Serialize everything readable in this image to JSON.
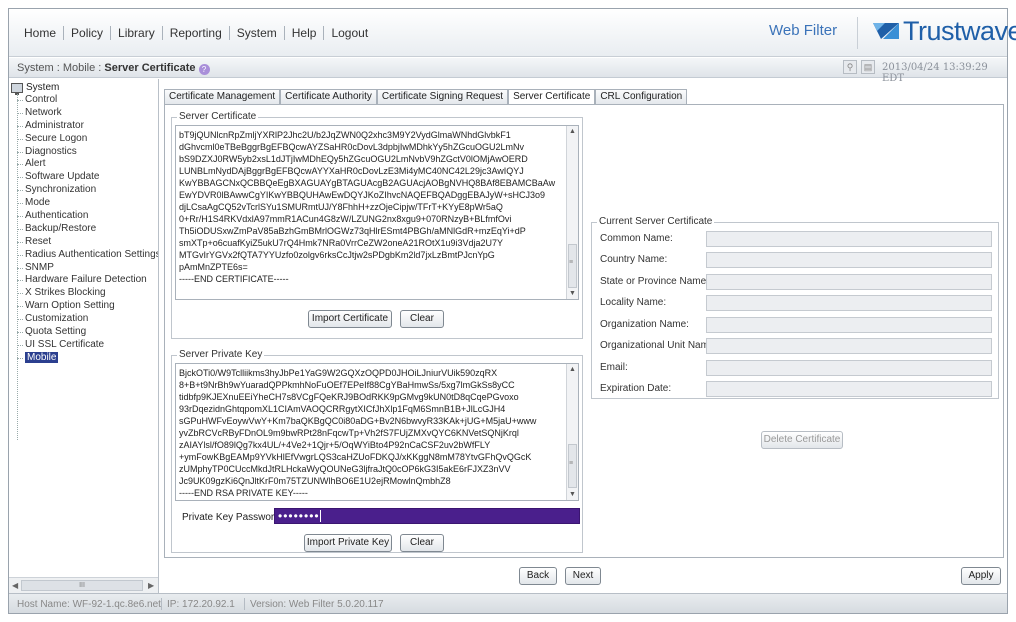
{
  "nav": {
    "items": [
      "Home",
      "Policy",
      "Library",
      "Reporting",
      "System",
      "Help",
      "Logout"
    ],
    "product_label": "Web Filter",
    "brand": "Trustwave",
    "brand_color": "#1f5fa8"
  },
  "breadcrumb": {
    "prefix": "System : Mobile : ",
    "current": "Server Certificate"
  },
  "timestamp": "2013/04/24 13:39:29 EDT",
  "sidebar": {
    "root": "System",
    "items": [
      "Control",
      "Network",
      "Administrator",
      "Secure Logon",
      "Diagnostics",
      "Alert",
      "Software Update",
      "Synchronization",
      "Mode",
      "Authentication",
      "Backup/Restore",
      "Reset",
      "Radius Authentication Settings",
      "SNMP",
      "Hardware Failure Detection",
      "X Strikes Blocking",
      "Warn Option Setting",
      "Customization",
      "Quota Setting",
      "UI SSL Certificate",
      "Mobile"
    ],
    "selected": "Mobile",
    "selected_color": "#2b3f8f",
    "scroll_grip": "III"
  },
  "tabs": [
    "Certificate Management",
    "Certificate Authority",
    "Certificate Signing Request",
    "Server Certificate",
    "CRL Configuration"
  ],
  "server_certificate": {
    "legend": "Server Certificate",
    "lines": [
      "bT9jQUNlcnRpZmljYXRlP2Jhc2U/b2JqZWN0Q2xhc3M9Y2VydGlmaWNhdGlvbkF1",
      "dGhvcml0eTBeBggrBgEFBQcwAYZSaHR0cDovL3dpbjIwMDhkYy5hZGcuOGU2LmNv",
      "bS9DZXJ0RW5yb2xsL1dJTjIwMDhEQy5hZGcuOGU2LmNvbV9hZGctV0lOMjAwOERD",
      "LUNBLmNydDAjBggrBgEFBQcwAYYXaHR0cDovLzE3Mi4yMC40NC42L29jc3AwIQYJ",
      "KwYBBAGCNxQCBBQeEgBXAGUAYgBTAGUAcgB2AGUAcjAOBgNVHQ8BAf8EBAMCBaAw",
      "EwYDVR0lBAwwCgYIKwYBBQUHAwEwDQYJKoZIhvcNAQEFBQADggEBAJyW+sHCJ3o9",
      "djLCsaAgCQ52vTcrlSYu1SMURmtUJ/Y8FhhH+zzOjeCipjw/TFrT+KYyE8pWr5aQ",
      "0+Rr/H1S4RKVdxlA97mmR1ACun4G8zW/LZUNG2nx8xgu9+070RNzyB+BLfmfOvi",
      "Th5iODUSxwZmPaV85aBzhGmBMrlOGWz73qHlrESmt4PBGh/aMNlGdR+mzEqYi+dP",
      "smXTp+o6cuafKyiZ5ukU7rQ4Hmk7NRa0VrrCeZW2oneA21ROtX1u9i3Vdja2U7Y",
      "MTGvIrYGVx2fQTA7YYUzfo0zolgv6rksCcJtjw2sPDgbKm2ld7jxLzBmtPJcnYpG",
      "pAmMnZPTE6s=",
      "-----END CERTIFICATE-----"
    ],
    "import_label": "Import Certificate",
    "clear_label": "Clear"
  },
  "server_private_key": {
    "legend": "Server Private Key",
    "lines": [
      "BjckOTi0/W9Tclliikms3hyJbPe1YaG9W2GQXzOQPD0JHOiLJniurVUik590zqRX",
      "8+B+t9NrBh9wYuaradQPPkmhNoFuOEf7EPeIf88CgYBaHmwSs/5xg7lmGkSs8yCC",
      "tidbfp9KJEXnuEEiYheCH7s8VCgFQeKRJ9BOdRKK9pGMvg9kUN0tD8qCqePGvoxo",
      "93rDqezidnGhtqpomXL1CIAmVAOQCRRgytXICfJhXlp1FqM6SmnB1B+JlLcGJH4",
      "sGPuHWFvEoywVwY+Km7baQKBgQC0i80aDG+Bv2N6bwvyR33KAk+jUG+M5jaU+www",
      "yvZbRCVcRByFDnOL9m9bwRPt28nFqcwTp+Vh2fS7FUjZMXvQYC6KNVetSQNjKrql",
      "zAIAYlsl/fO89lQg7kx4UL/+4Ve2+1Qjr+5/OqWYiBto4P92nCaCSF2uv2bWfFLY",
      "+ymFowKBgEAMp9YVkHlEfVwgrLQS3caHZUoFDKQJ/xKKggN8mM78YtvGFhQvQGcK",
      "zUMphyTP0CUccMkdJtRLHckaWyQOUNeG3ljfraJtQ0cOP6kG3I5akE6rFJXZ3nVV",
      "Jc9UK09gzKi6QnJltKrF0m75TZUNWlhBO6E1U2ejRMowlnQmbhZ8",
      "-----END RSA PRIVATE KEY-----"
    ],
    "password_label": "Private Key Password",
    "password_value": "••••••••",
    "password_color": "#4a1f8c",
    "import_label": "Import Private Key",
    "clear_label": "Clear"
  },
  "current_certificate": {
    "legend": "Current Server Certificate",
    "fields": [
      "Common Name:",
      "Country Name:",
      "State or Province Name:",
      "Locality Name:",
      "Organization Name:",
      "Organizational Unit Name:",
      "Email:",
      "Expiration Date:"
    ],
    "delete_label": "Delete Certificate"
  },
  "footer": {
    "back": "Back",
    "next": "Next",
    "apply": "Apply"
  },
  "status": {
    "host": "Host Name: WF-92-1.qc.8e6.net",
    "ip": "IP: 172.20.92.1",
    "version": "Version: Web Filter 5.0.20.117"
  }
}
